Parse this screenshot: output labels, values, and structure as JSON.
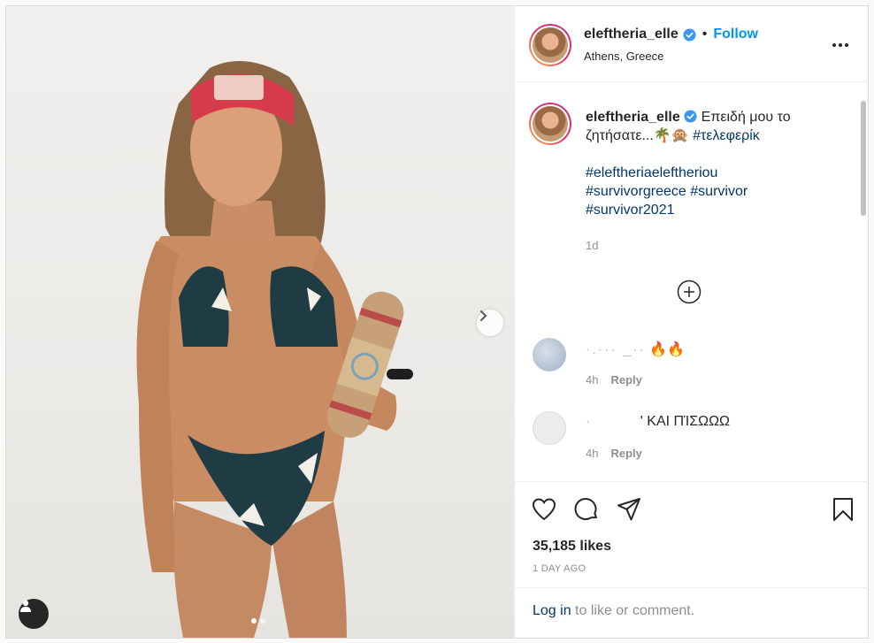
{
  "post": {
    "username": "eleftheria_elle",
    "follow_label": "Follow",
    "separator": "•",
    "location": "Athens, Greece",
    "verified_icon": "verified-badge-icon",
    "more_icon": "more-options-icon"
  },
  "caption": {
    "text_line1": "Επειδή μου το ζητήσατε...🌴🙊",
    "hashtag1": "#τελεφερίκ",
    "hashtags": [
      "#eleftheriaeleftheriou",
      "#survivorgreece",
      "#survivor",
      "#survivor2021"
    ],
    "time": "1d"
  },
  "comments": [
    {
      "text_hidden": "·.··· _··",
      "text": "🔥🔥",
      "time": "4h",
      "reply": "Reply"
    },
    {
      "text_hidden": "·",
      "text": "' ΚΑΙ ΠΊΣΩΩΩ",
      "time": "4h",
      "reply": "Reply"
    }
  ],
  "stats": {
    "likes": "35,185 likes",
    "date": "1 DAY AGO"
  },
  "login": {
    "link": "Log in",
    "rest": " to like or comment."
  },
  "colors": {
    "accent": "#0095f6",
    "hashtag": "#00376b",
    "muted": "#8e8e8e"
  }
}
